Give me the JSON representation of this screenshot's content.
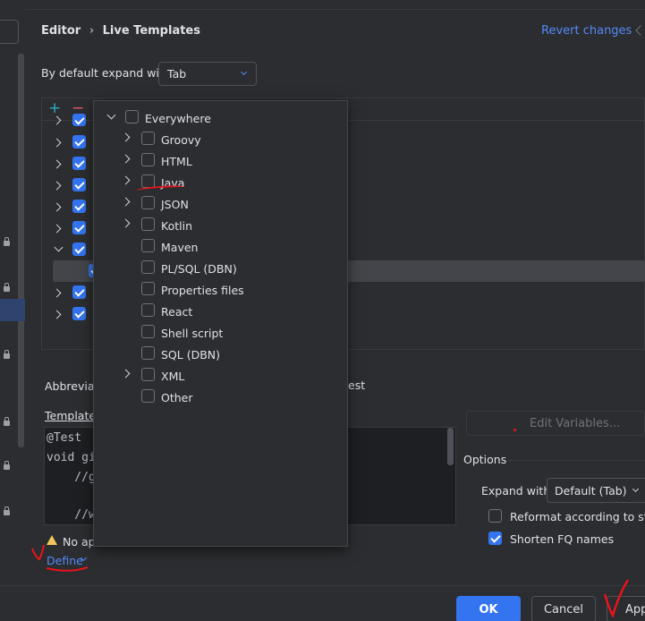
{
  "breadcrumb": {
    "parent": "Editor",
    "separator": "›",
    "current": "Live Templates"
  },
  "revert_label": "Revert changes",
  "expand_row": {
    "label": "By default expand with",
    "value": "Tab"
  },
  "toolbar": {
    "add": "+",
    "remove": "−"
  },
  "abbrev": {
    "label_start": "Abbreviati",
    "tail": "est"
  },
  "template_text_label": "Template",
  "code_lines": [
    "@Test",
    "void gi",
    "    //g",
    "",
    "    //w"
  ],
  "edit_variables_label": "Edit Variables...",
  "options": {
    "title": "Options",
    "expand_label": "Expand with",
    "expand_value": "Default (Tab)",
    "reformat_label": "Reformat according to style",
    "shorten_label": "Shorten FQ names"
  },
  "warning_text": "No ap",
  "define_label": "Define",
  "context_popup": {
    "items": [
      {
        "label": "Everywhere",
        "checked": false
      },
      {
        "label": "Groovy",
        "checked": false
      },
      {
        "label": "HTML",
        "checked": false
      },
      {
        "label": "Java",
        "checked": false
      },
      {
        "label": "JSON",
        "checked": false
      },
      {
        "label": "Kotlin",
        "checked": false
      },
      {
        "label": "Maven",
        "checked": false
      },
      {
        "label": "PL/SQL (DBN)",
        "checked": false
      },
      {
        "label": "Properties files",
        "checked": false
      },
      {
        "label": "React",
        "checked": false
      },
      {
        "label": "Shell script",
        "checked": false
      },
      {
        "label": "SQL (DBN)",
        "checked": false
      },
      {
        "label": "XML",
        "checked": false
      },
      {
        "label": "Other",
        "checked": false
      }
    ]
  },
  "buttons": {
    "ok": "OK",
    "cancel": "Cancel",
    "apply": "App"
  }
}
